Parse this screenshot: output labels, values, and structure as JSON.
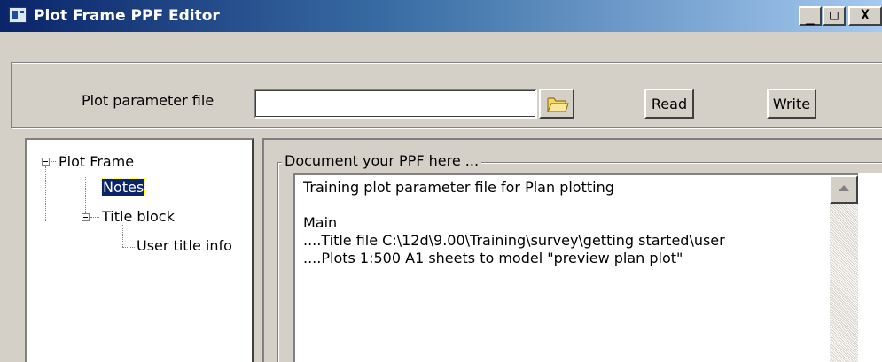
{
  "window": {
    "title": "Plot Frame PPF Editor",
    "controls": {
      "minimize": "_",
      "maximize": "□",
      "close": "X"
    }
  },
  "param_file": {
    "label": "Plot parameter file",
    "value": "",
    "browse_icon": "folder-icon",
    "read_label": "Read",
    "write_label": "Write"
  },
  "tree": {
    "items": [
      {
        "label": "Plot Frame",
        "expanded": true
      },
      {
        "label": "Notes",
        "selected": true
      },
      {
        "label": "Title block",
        "expanded": true
      },
      {
        "label": "User title info"
      }
    ]
  },
  "notes": {
    "group_label": "Document your PPF here ...",
    "lines": [
      "Training plot parameter file for Plan plotting",
      "",
      "Main",
      "....Title file C:\\12d\\9.00\\Training\\survey\\getting started\\user",
      "....Plots 1:500 A1 sheets to model \"preview plan plot\""
    ]
  },
  "colors": {
    "titlebar_start": "#0a246a",
    "titlebar_end": "#a6caf0",
    "window_bg": "#d4d0c8",
    "selection": "#0a246a"
  }
}
